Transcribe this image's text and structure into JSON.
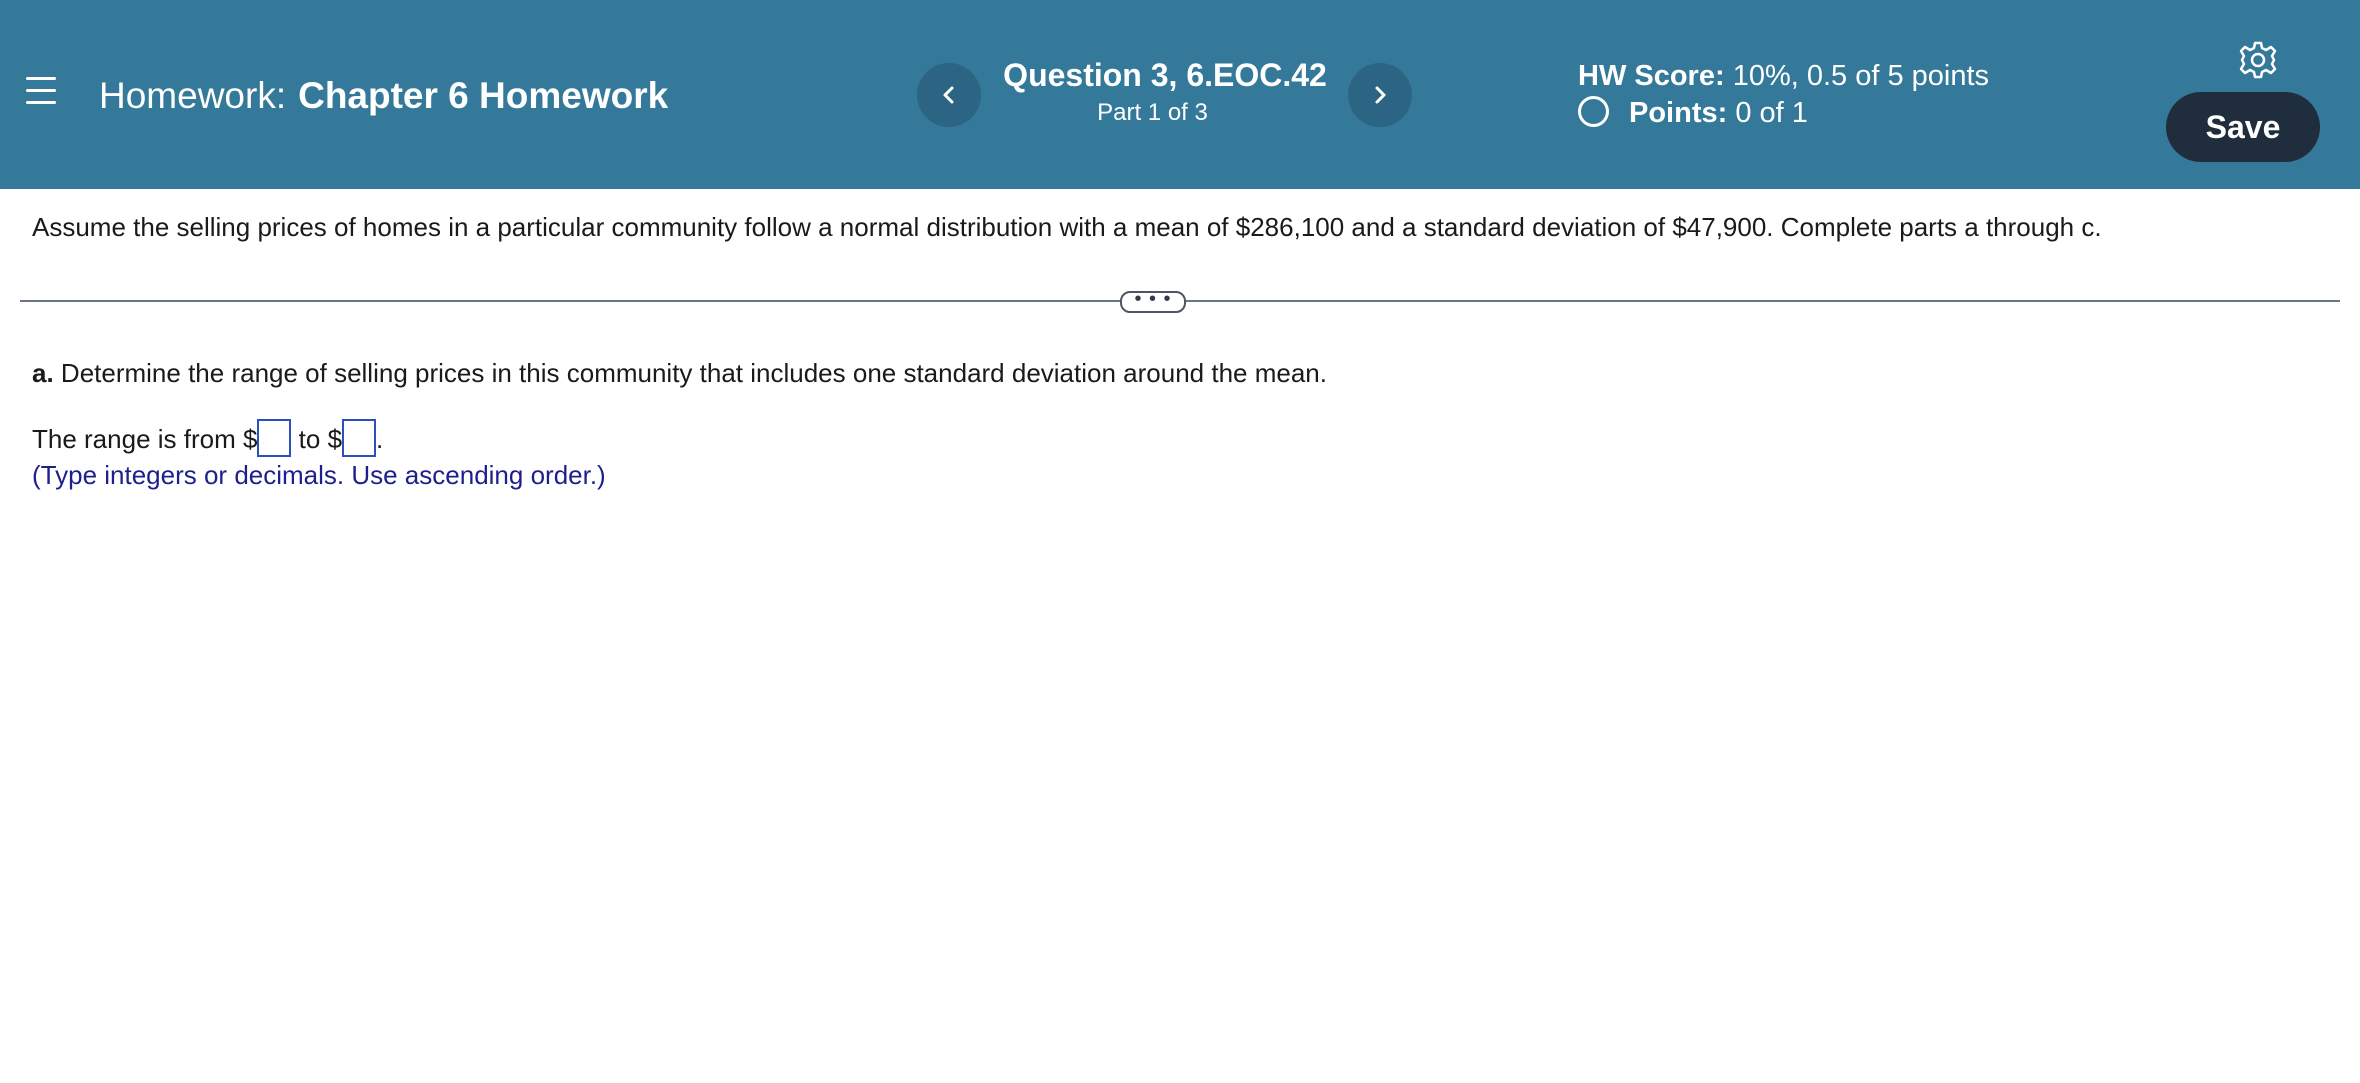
{
  "header": {
    "homework_prefix": "Homework:",
    "homework_name": "Chapter 6 Homework",
    "question_title": "Question 3, 6.EOC.42",
    "question_part": "Part 1 of 3",
    "score_label": "HW Score:",
    "score_value": "10%, 0.5 of 5 points",
    "points_label": "Points:",
    "points_value": "0 of 1",
    "save_label": "Save",
    "icons": {
      "menu": "hamburger-menu-icon",
      "prev": "chevron-left-icon",
      "next": "chevron-right-icon",
      "settings": "gear-icon",
      "status": "empty-circle-icon"
    },
    "colors": {
      "header_bg": "#34799a",
      "nav_button_bg": "#2b6583",
      "save_bg": "#1f2d3d"
    }
  },
  "problem": {
    "statement": "Assume the selling prices of homes in a particular community follow a normal distribution with a mean of $286,100 and a standard deviation of $47,900. Complete parts a through c.",
    "expand_label": "• • •"
  },
  "part_a": {
    "letter": "a.",
    "prompt": "Determine the range of selling prices in this community that includes one standard deviation around the mean.",
    "answer_prefix": "The range is from $",
    "answer_middle": " to $",
    "answer_suffix": ".",
    "hint": "(Type integers or decimals. Use ascending order.)",
    "hint_color": "#1c1f8c"
  }
}
